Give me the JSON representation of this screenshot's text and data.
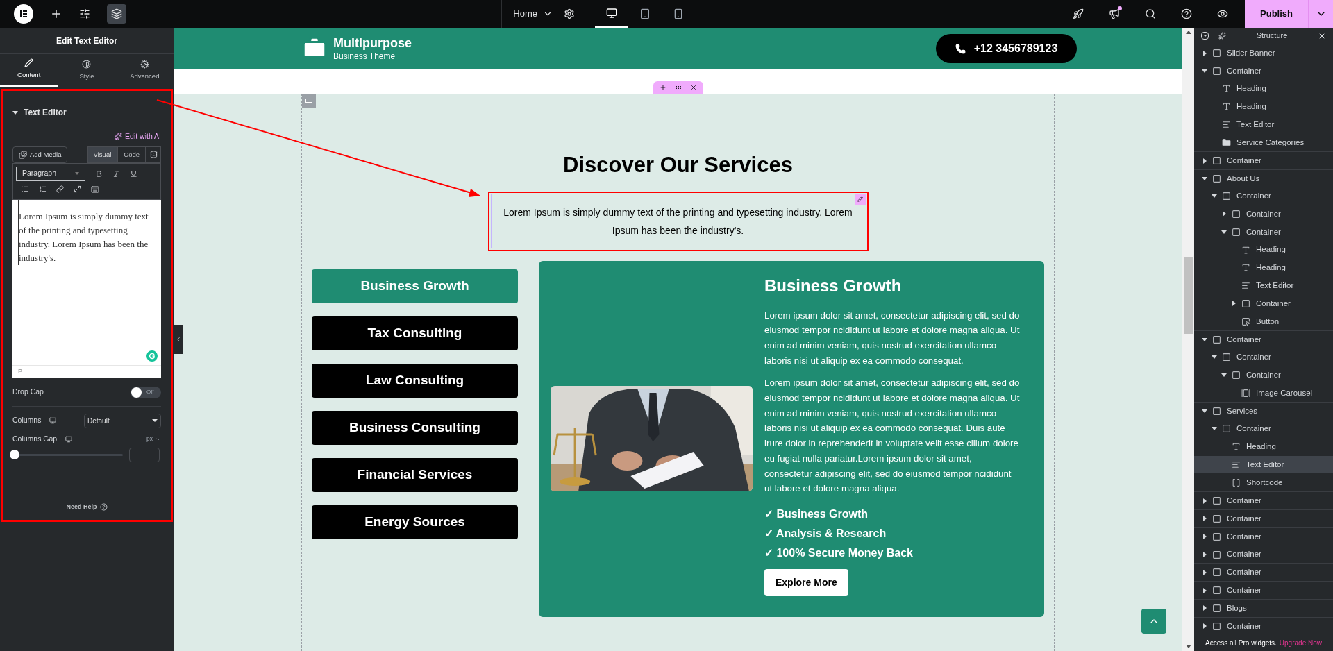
{
  "topbar": {
    "page": "Home",
    "devices": [
      {
        "kind": "desktop",
        "selected": true
      },
      {
        "kind": "tablet",
        "selected": false
      },
      {
        "kind": "mobile",
        "selected": false
      }
    ],
    "publish": "Publish"
  },
  "panel": {
    "title": "Edit Text Editor",
    "tabs": [
      {
        "label": "Content",
        "kind": "pencil",
        "selected": true
      },
      {
        "label": "Style",
        "kind": "contrast",
        "selected": false
      },
      {
        "label": "Advanced",
        "kind": "gear",
        "selected": false
      }
    ],
    "section": {
      "title": "Text Editor",
      "expanded": true
    },
    "ai_link": "Edit with AI",
    "add_media": "Add Media",
    "editor_tabs": [
      {
        "label": "Visual",
        "selected": true
      },
      {
        "label": "Code",
        "selected": false
      }
    ],
    "format": "Paragraph",
    "editor_text": "Lorem Ipsum is simply dummy text of the printing and typesetting industry. Lorem Ipsum has been the industry's.",
    "editor_status": "P",
    "drop_cap": {
      "label": "Drop Cap",
      "on": false,
      "off_label": "Off"
    },
    "columns": {
      "label": "Columns",
      "value": "Default"
    },
    "columns_gap": {
      "label": "Columns Gap",
      "unit": "px",
      "level": 0
    },
    "help": "Need Help"
  },
  "site": {
    "logo_title": "Multipurpose",
    "logo_subtitle": "Business Theme",
    "phone": "+12 3456789123",
    "heading": "Discover Our Services",
    "intro": "Lorem Ipsum is simply dummy text of the printing and typesetting industry. Lorem Ipsum has been the industry's.",
    "services": [
      {
        "label": "Business Growth",
        "selected": true
      },
      {
        "label": "Tax Consulting",
        "selected": false
      },
      {
        "label": "Law Consulting",
        "selected": false
      },
      {
        "label": "Business Consulting",
        "selected": false
      },
      {
        "label": "Financial Services",
        "selected": false
      },
      {
        "label": "Energy Sources",
        "selected": false
      }
    ],
    "card": {
      "title": "Business Growth",
      "paragraphs": [
        "Lorem ipsum dolor sit amet, consectetur adipiscing elit, sed do eiusmod tempor ncididunt ut labore et dolore magna aliqua. Ut enim ad minim veniam, quis nostrud exercitation ullamco laboris nisi ut aliquip ex ea commodo consequat.",
        "Lorem ipsum dolor sit amet, consectetur adipiscing elit, sed do eiusmod tempor ncididunt ut labore et dolore magna aliqua. Ut enim ad minim veniam, quis nostrud exercitation ullamco laboris nisi ut aliquip ex ea commodo consequat. Duis aute irure dolor in reprehenderit in voluptate velit esse cillum dolore eu fugiat nulla pariatur.Lorem ipsum dolor sit amet, consectetur adipiscing elit, sed do eiusmod tempor ncididunt ut labore et dolore magna aliqua."
      ],
      "checklist": [
        "✓ Business Growth",
        "✓ Analysis & Research",
        "✓ 100% Secure Money Back"
      ],
      "button": "Explore More"
    }
  },
  "structure": {
    "title": "Structure",
    "footer": "Access all Pro widgets.",
    "upgrade": "Upgrade Now",
    "items": [
      {
        "label": "Slider Banner",
        "kind": "container",
        "expanded": false,
        "selected": false
      },
      {
        "label": "Container",
        "kind": "container",
        "expanded": true,
        "selected": false,
        "children": [
          {
            "label": "Heading",
            "kind": "heading",
            "selected": false
          },
          {
            "label": "Heading",
            "kind": "heading",
            "selected": false
          },
          {
            "label": "Text Editor",
            "kind": "text",
            "selected": false
          },
          {
            "label": "Service Categories",
            "kind": "folder",
            "selected": false
          }
        ]
      },
      {
        "label": "Container",
        "kind": "container",
        "expanded": false,
        "selected": false
      },
      {
        "label": "About Us",
        "kind": "container",
        "expanded": true,
        "selected": false,
        "children": [
          {
            "label": "Container",
            "kind": "container",
            "expanded": true,
            "selected": false,
            "children": [
              {
                "label": "Container",
                "kind": "container",
                "expanded": false,
                "selected": false
              },
              {
                "label": "Container",
                "kind": "container",
                "expanded": true,
                "selected": false,
                "children": [
                  {
                    "label": "Heading",
                    "kind": "heading",
                    "selected": false
                  },
                  {
                    "label": "Heading",
                    "kind": "heading",
                    "selected": false
                  },
                  {
                    "label": "Text Editor",
                    "kind": "text",
                    "selected": false
                  },
                  {
                    "label": "Container",
                    "kind": "container",
                    "expanded": false,
                    "selected": false
                  },
                  {
                    "label": "Button",
                    "kind": "button",
                    "selected": false
                  }
                ]
              }
            ]
          }
        ]
      },
      {
        "label": "Container",
        "kind": "container",
        "expanded": true,
        "selected": false,
        "children": [
          {
            "label": "Container",
            "kind": "container",
            "expanded": true,
            "selected": false,
            "children": [
              {
                "label": "Container",
                "kind": "container",
                "expanded": true,
                "selected": false,
                "children": [
                  {
                    "label": "Image Carousel",
                    "kind": "carousel",
                    "selected": false
                  }
                ]
              }
            ]
          }
        ]
      },
      {
        "label": "Services",
        "kind": "container",
        "expanded": true,
        "selected": false,
        "children": [
          {
            "label": "Container",
            "kind": "container",
            "expanded": true,
            "selected": false,
            "children": [
              {
                "label": "Heading",
                "kind": "heading",
                "selected": false
              },
              {
                "label": "Text Editor",
                "kind": "text",
                "selected": true
              },
              {
                "label": "Shortcode",
                "kind": "shortcode",
                "selected": false
              }
            ]
          }
        ]
      },
      {
        "label": "Container",
        "kind": "container",
        "expanded": false,
        "selected": false
      },
      {
        "label": "Container",
        "kind": "container",
        "expanded": false,
        "selected": false
      },
      {
        "label": "Container",
        "kind": "container",
        "expanded": false,
        "selected": false
      },
      {
        "label": "Container",
        "kind": "container",
        "expanded": false,
        "selected": false
      },
      {
        "label": "Container",
        "kind": "container",
        "expanded": false,
        "selected": false
      },
      {
        "label": "Container",
        "kind": "container",
        "expanded": false,
        "selected": false
      },
      {
        "label": "Blogs",
        "kind": "container",
        "expanded": false,
        "selected": false
      },
      {
        "label": "Container",
        "kind": "container",
        "expanded": false,
        "selected": false
      }
    ]
  }
}
